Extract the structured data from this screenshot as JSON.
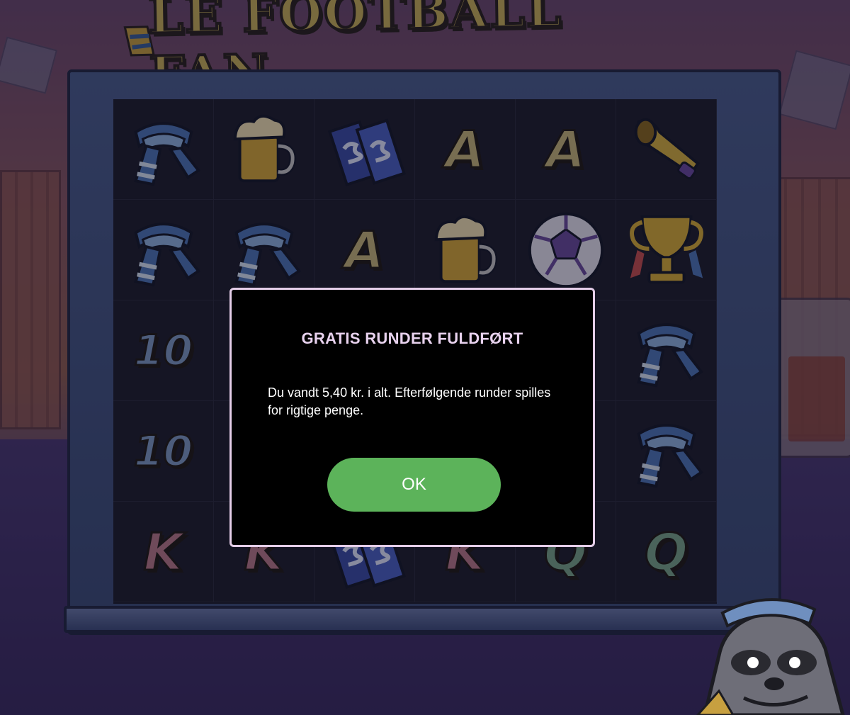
{
  "game": {
    "title": "LE FOOTBALL FAN"
  },
  "reels": {
    "rows": [
      [
        "scarf",
        "beer",
        "ticket",
        "A",
        "A",
        "horn"
      ],
      [
        "scarf",
        "scarf",
        "A",
        "beer",
        "ball",
        "trophy"
      ],
      [
        "10",
        "",
        "",
        "",
        "",
        "scarf"
      ],
      [
        "10",
        "",
        "",
        "",
        "",
        "scarf"
      ],
      [
        "K",
        "K",
        "ticket",
        "K",
        "Q",
        "Q"
      ]
    ]
  },
  "dialog": {
    "title": "GRATIS RUNDER FULDFØRT",
    "message": "Du vandt 5,40 kr. i alt. Efterfølgende runder spilles for rigtige penge.",
    "ok_label": "OK"
  },
  "colors": {
    "ok_button": "#5cb35a",
    "dialog_border": "#e4cde8",
    "dialog_title": "#e8d2ee",
    "dialog_bg": "#000000"
  }
}
